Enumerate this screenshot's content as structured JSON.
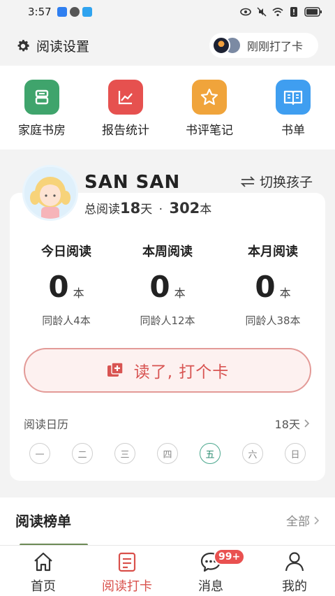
{
  "status_bar": {
    "time": "3:57"
  },
  "header": {
    "settings_label": "阅读设置",
    "checkin_status": "刚刚打了卡"
  },
  "quick_actions": [
    {
      "label": "家庭书房",
      "icon": "bookshelf-icon",
      "color": "#3fa46c"
    },
    {
      "label": "报告统计",
      "icon": "chart-icon",
      "color": "#e6514f"
    },
    {
      "label": "书评笔记",
      "icon": "star-icon",
      "color": "#f0a43b"
    },
    {
      "label": "书单",
      "icon": "open-book-icon",
      "color": "#3f9ef0"
    }
  ],
  "child": {
    "name": "SAN SAN",
    "total_prefix": "总阅读",
    "total_days": "18",
    "days_unit": "天",
    "separator": "·",
    "total_books": "302",
    "books_unit": "本",
    "switch_label": "切换孩子"
  },
  "stats": [
    {
      "label": "今日阅读",
      "value": "0",
      "unit": "本",
      "peer": "同龄人4本"
    },
    {
      "label": "本周阅读",
      "value": "0",
      "unit": "本",
      "peer": "同龄人12本"
    },
    {
      "label": "本月阅读",
      "value": "0",
      "unit": "本",
      "peer": "同龄人38本"
    }
  ],
  "checkin_button": {
    "label": "读了, 打个卡"
  },
  "calendar": {
    "label": "阅读日历",
    "days": "18天",
    "weekdays": [
      "一",
      "二",
      "三",
      "四",
      "五",
      "六",
      "日"
    ],
    "today": "五"
  },
  "ranking": {
    "title": "阅读榜单",
    "all_label": "全部"
  },
  "bottom_nav": [
    {
      "label": "首页",
      "icon": "home-icon",
      "active": false
    },
    {
      "label": "阅读打卡",
      "icon": "reading-checkin-icon",
      "active": true
    },
    {
      "label": "消息",
      "icon": "message-icon",
      "active": false,
      "badge": "99+"
    },
    {
      "label": "我的",
      "icon": "profile-icon",
      "active": false
    }
  ],
  "colors": {
    "accent": "#d9504b",
    "today": "#4aa78d"
  }
}
